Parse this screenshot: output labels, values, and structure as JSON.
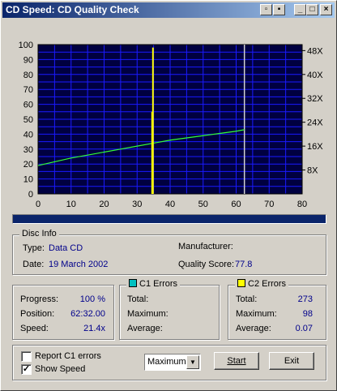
{
  "window": {
    "title": "CD Speed: CD Quality Check"
  },
  "chart_data": {
    "type": "line",
    "x_ticks": [
      "0",
      "10",
      "20",
      "30",
      "40",
      "50",
      "60",
      "70",
      "80"
    ],
    "y_left_ticks": [
      "0",
      "10",
      "20",
      "30",
      "40",
      "50",
      "60",
      "70",
      "80",
      "90",
      "100"
    ],
    "y_right_ticks": [
      "8X",
      "16X",
      "24X",
      "32X",
      "40X",
      "48X"
    ],
    "xlim": [
      0,
      80
    ],
    "ylim": [
      0,
      100
    ],
    "grid": true,
    "background": "#000040",
    "grid_color": "#1a1aff",
    "speed_series": {
      "color": "#33ff33",
      "x": [
        0,
        5,
        10,
        15,
        20,
        25,
        30,
        35,
        40,
        45,
        50,
        55,
        60,
        62.5
      ],
      "y": [
        19,
        21.5,
        24,
        26,
        28,
        30,
        32,
        34,
        36,
        37.5,
        39,
        40.5,
        42,
        43
      ]
    },
    "c2_error_markers": [
      {
        "x": 34.8,
        "y": 98,
        "color": "#ffff00"
      }
    ],
    "c2_secondary_marker": {
      "x": 34.8,
      "y": 55,
      "color": "#ffff00"
    },
    "end_marker": {
      "x": 62.5,
      "y": 100,
      "color": "#d0d0d0"
    }
  },
  "progress_bar": {
    "fraction": 1.0,
    "color": "#0a246a"
  },
  "disc_info": {
    "heading": "Disc Info",
    "type_label": "Type:",
    "type_value": "Data CD",
    "date_label": "Date:",
    "date_value": "19 March 2002",
    "manufacturer_label": "Manufacturer:",
    "manufacturer_value": "",
    "quality_label": "Quality Score:",
    "quality_value": "77.8"
  },
  "stats": {
    "progress_label": "Progress:",
    "progress_value": "100 %",
    "position_label": "Position:",
    "position_value": "62:32.00",
    "speed_label": "Speed:",
    "speed_value": "21.4x"
  },
  "c1": {
    "heading": "C1 Errors",
    "color": "#00c0c0",
    "total_label": "Total:",
    "total_value": "",
    "max_label": "Maximum:",
    "max_value": "",
    "avg_label": "Average:",
    "avg_value": ""
  },
  "c2": {
    "heading": "C2 Errors",
    "color": "#ffff00",
    "total_label": "Total:",
    "total_value": "273",
    "max_label": "Maximum:",
    "max_value": "98",
    "avg_label": "Average:",
    "avg_value": "0.07"
  },
  "options": {
    "report_c1_label": "Report C1 errors",
    "report_c1_checked": false,
    "show_speed_label": "Show Speed",
    "show_speed_checked": true,
    "mode_select": "Maximum"
  },
  "buttons": {
    "start": "Start",
    "exit": "Exit"
  },
  "icons": {
    "save": "save-icon",
    "floppy": "floppy-icon",
    "minimize": "minimize-icon",
    "maximize": "maximize-icon",
    "close": "close-icon"
  }
}
